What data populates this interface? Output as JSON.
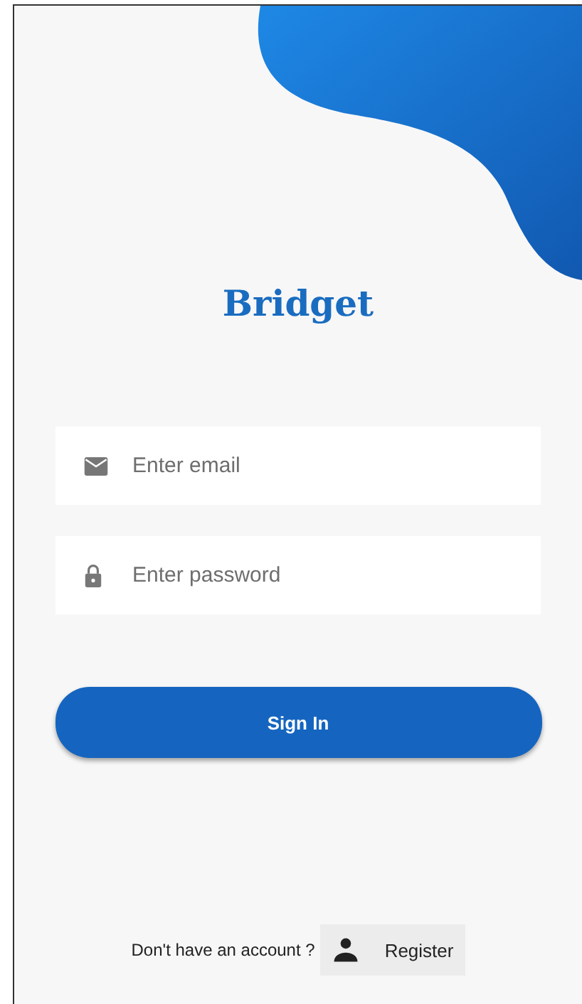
{
  "app": {
    "title": "Bridget"
  },
  "fields": [
    {
      "kind": "email",
      "placeholder": "Enter email"
    },
    {
      "kind": "password",
      "placeholder": "Enter password"
    }
  ],
  "sign_in_button": {
    "label": "Sign In"
  },
  "footer": {
    "prompt": "Don't have an account ?",
    "register_button": {
      "label": "Register"
    }
  }
}
